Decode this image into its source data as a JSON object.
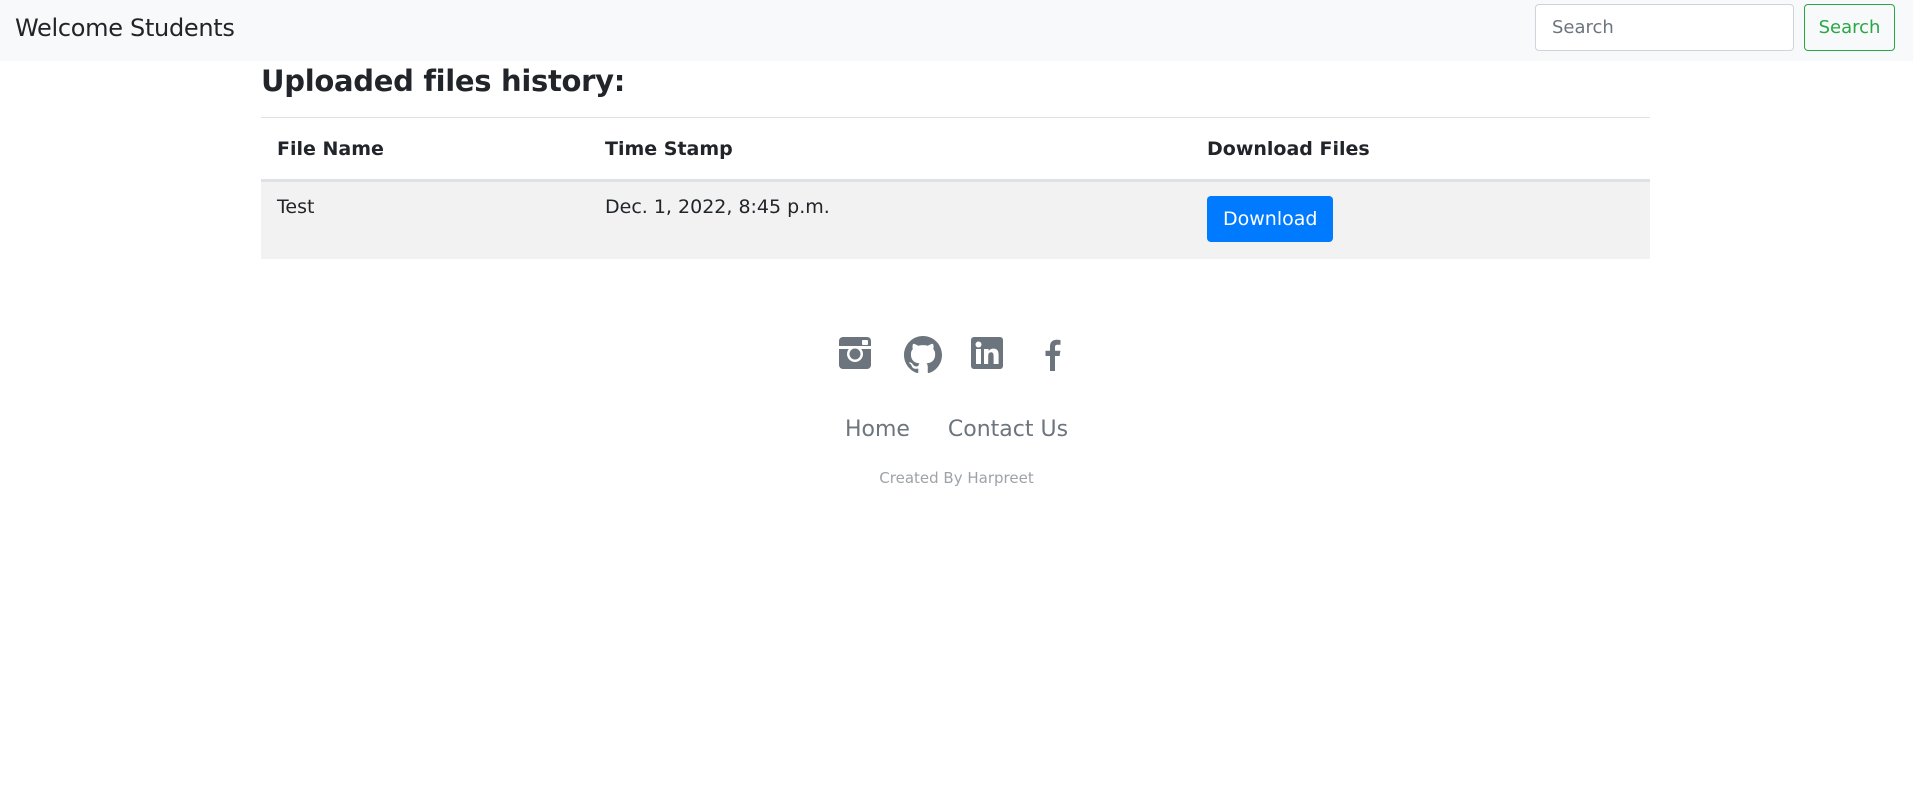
{
  "navbar": {
    "brand": "Welcome Students",
    "search_placeholder": "Search",
    "search_button": "Search"
  },
  "main": {
    "heading": "Uploaded files history:",
    "table": {
      "headers": [
        "File Name",
        "Time Stamp",
        "Download Files"
      ],
      "rows": [
        {
          "file_name": "Test",
          "timestamp": "Dec. 1, 2022, 8:45 p.m.",
          "download_label": "Download"
        }
      ]
    }
  },
  "footer": {
    "social_icons": [
      "instagram-icon",
      "github-icon",
      "linkedin-icon",
      "facebook-icon"
    ],
    "links": [
      "Home",
      "Contact Us"
    ],
    "credit": "Created By Harpreet"
  },
  "colors": {
    "navbar_bg": "#f8f9fa",
    "search_accent": "#28a745",
    "download_button": "#007bff",
    "icon_gray": "#6c757d",
    "row_stripe": "#f2f2f2"
  }
}
